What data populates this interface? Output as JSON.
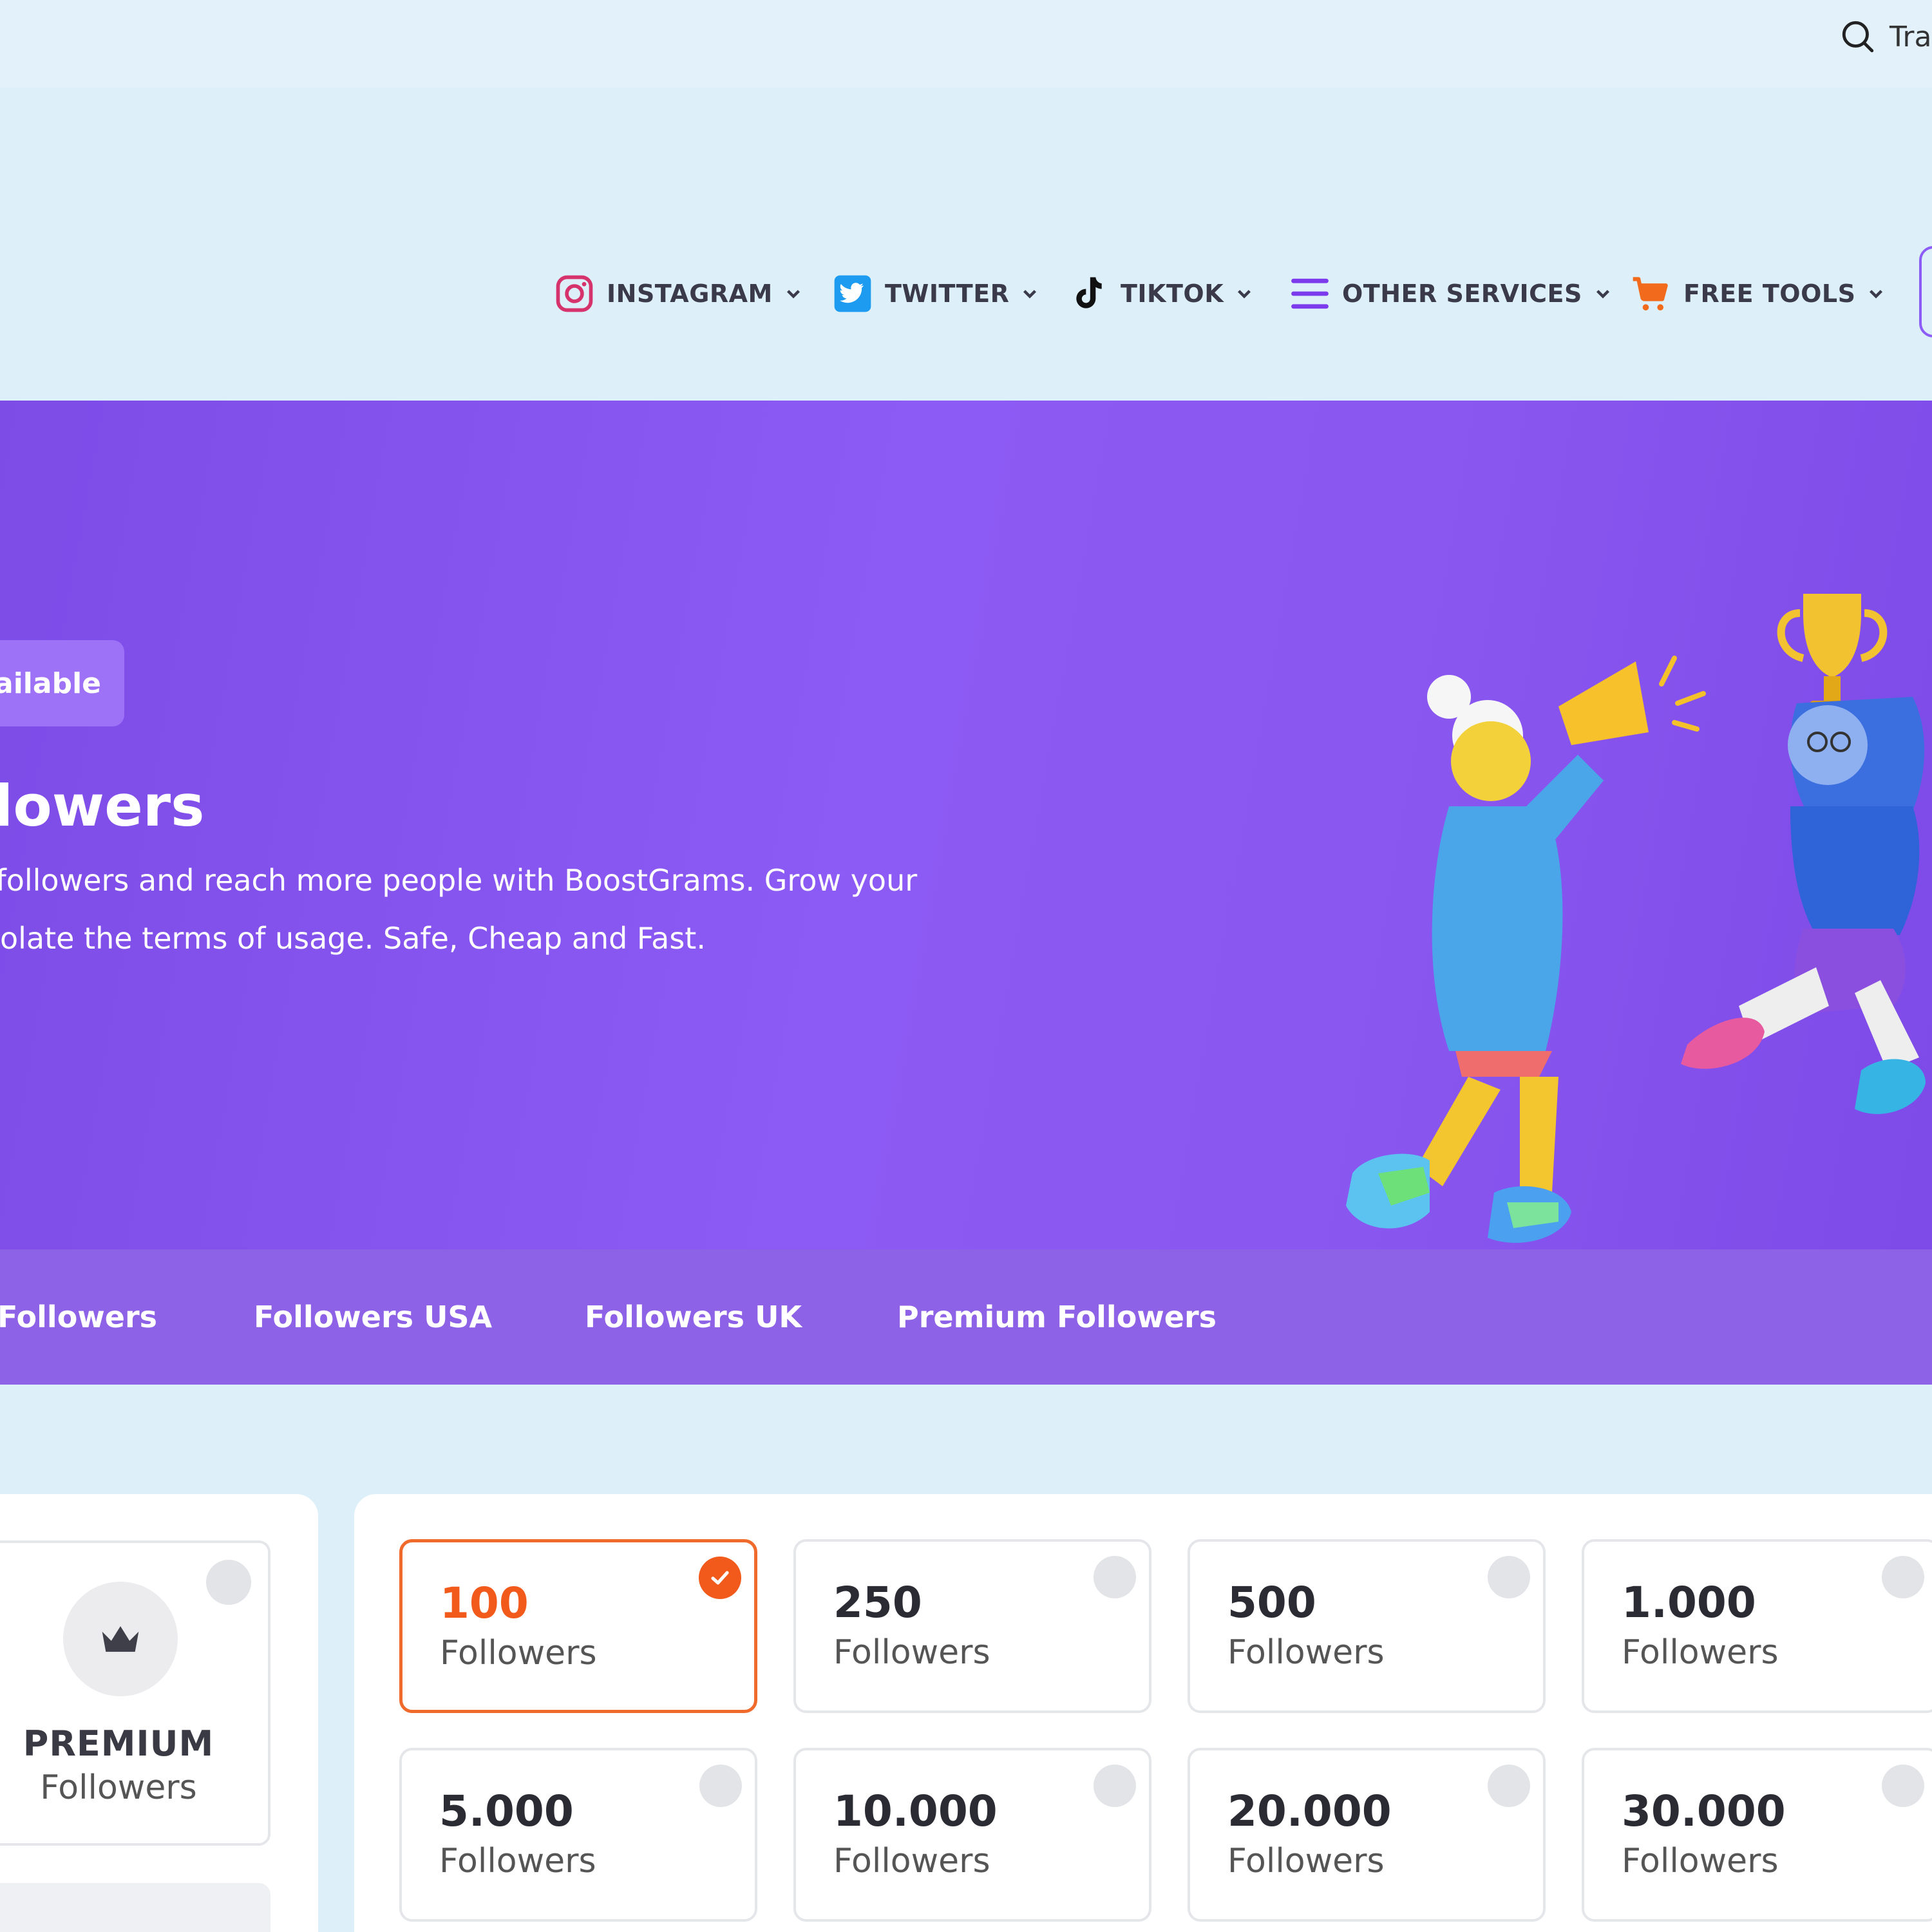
{
  "topbar": {
    "search_text": "Tra"
  },
  "nav": {
    "items": [
      {
        "label": "INSTAGRAM",
        "icon": "instagram-icon"
      },
      {
        "label": "TWITTER",
        "icon": "twitter-icon"
      },
      {
        "label": "TIKTOK",
        "icon": "tiktok-icon"
      },
      {
        "label": "OTHER SERVICES",
        "icon": "menu-icon"
      },
      {
        "label": "FREE TOOLS",
        "icon": "cart-icon"
      }
    ]
  },
  "hero": {
    "badge": "ailable",
    "title": "llowers",
    "description": "r followers and reach more people with BoostGrams. Grow your  violate the terms of usage. Safe, Cheap and Fast."
  },
  "subnav": {
    "items": [
      "Followers",
      "Followers USA",
      "Followers UK",
      "Premium Followers"
    ]
  },
  "premium_card": {
    "title": "PREMIUM",
    "subtitle": "Followers"
  },
  "packages": [
    {
      "amount": "100",
      "unit": "Followers",
      "selected": true
    },
    {
      "amount": "250",
      "unit": "Followers",
      "selected": false
    },
    {
      "amount": "500",
      "unit": "Followers",
      "selected": false
    },
    {
      "amount": "1.000",
      "unit": "Followers",
      "selected": false
    },
    {
      "amount": "5.000",
      "unit": "Followers",
      "selected": false
    },
    {
      "amount": "10.000",
      "unit": "Followers",
      "selected": false
    },
    {
      "amount": "20.000",
      "unit": "Followers",
      "selected": false
    },
    {
      "amount": "30.000",
      "unit": "Followers",
      "selected": false
    }
  ],
  "colors": {
    "hero_purple": "#8a57f0",
    "subnav_purple": "#8e62e6",
    "accent_orange": "#f15a1b",
    "page_bg": "#ddf0fa"
  }
}
